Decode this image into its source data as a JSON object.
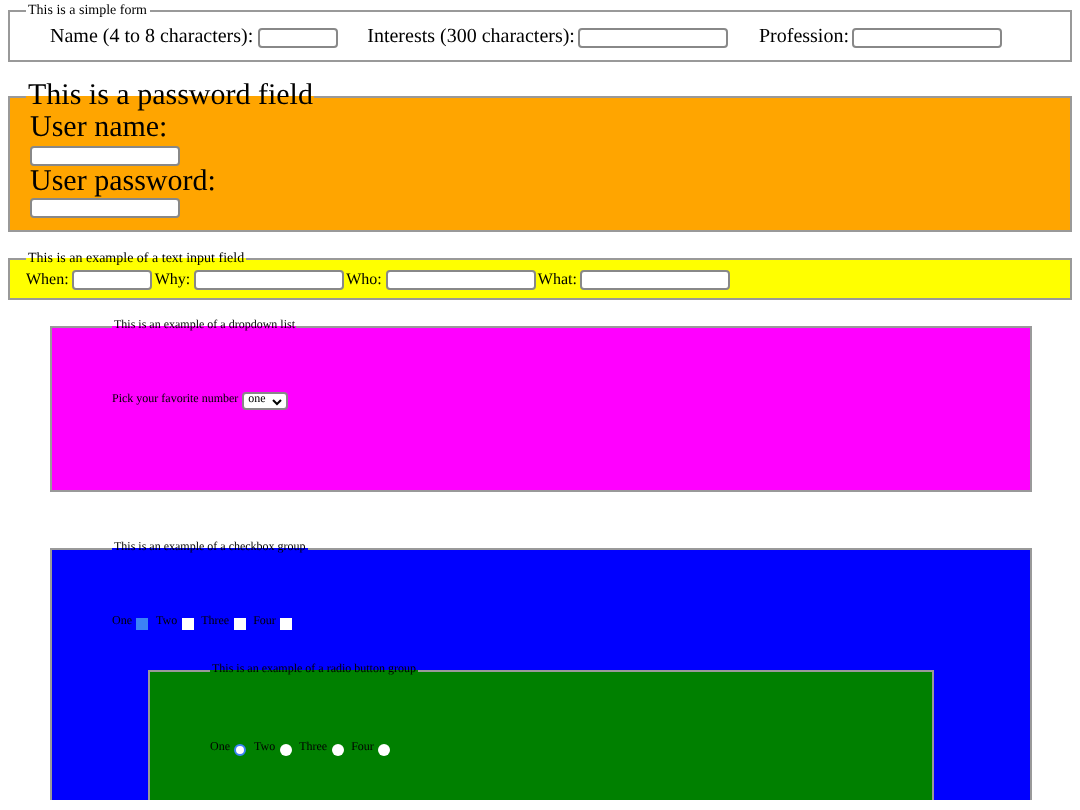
{
  "fieldsets": [
    {
      "kind": "text-row",
      "color": "#ffffff",
      "legend": "This is a simple form",
      "fields": [
        {
          "label": "Name (4 to 8 characters):"
        },
        {
          "label": "Interests (300 characters):"
        },
        {
          "label": "Profession:"
        }
      ]
    },
    {
      "kind": "stacked",
      "color": "#ffa500",
      "legend": "This is a password field",
      "fields": [
        {
          "label": "User name:"
        },
        {
          "label": "User password:"
        }
      ]
    },
    {
      "kind": "text-row",
      "color": "#ffff00",
      "legend": "This is an example of a text input field",
      "fields": [
        {
          "label": "When:"
        },
        {
          "label": "Why:"
        },
        {
          "label": "Who:"
        },
        {
          "label": "What:"
        }
      ]
    },
    {
      "kind": "dropdown",
      "color": "#ff00ff",
      "legend": "This is an example of a dropdown list",
      "label": "Pick your favorite number",
      "value": "one"
    },
    {
      "kind": "checkbox-group",
      "color": "#0000ff",
      "legend": "This is an example of a checkbox group",
      "options": [
        {
          "label": "One",
          "checked": true
        },
        {
          "label": "Two",
          "checked": false
        },
        {
          "label": "Three",
          "checked": false
        },
        {
          "label": "Four",
          "checked": false
        }
      ],
      "children": [
        {
          "kind": "radio-group",
          "color": "#008000",
          "legend": "This is an example of a radio button group",
          "options": [
            {
              "label": "One",
              "selected": true
            },
            {
              "label": "Two",
              "selected": false
            },
            {
              "label": "Three",
              "selected": false
            },
            {
              "label": "Four",
              "selected": false
            }
          ]
        }
      ]
    }
  ]
}
